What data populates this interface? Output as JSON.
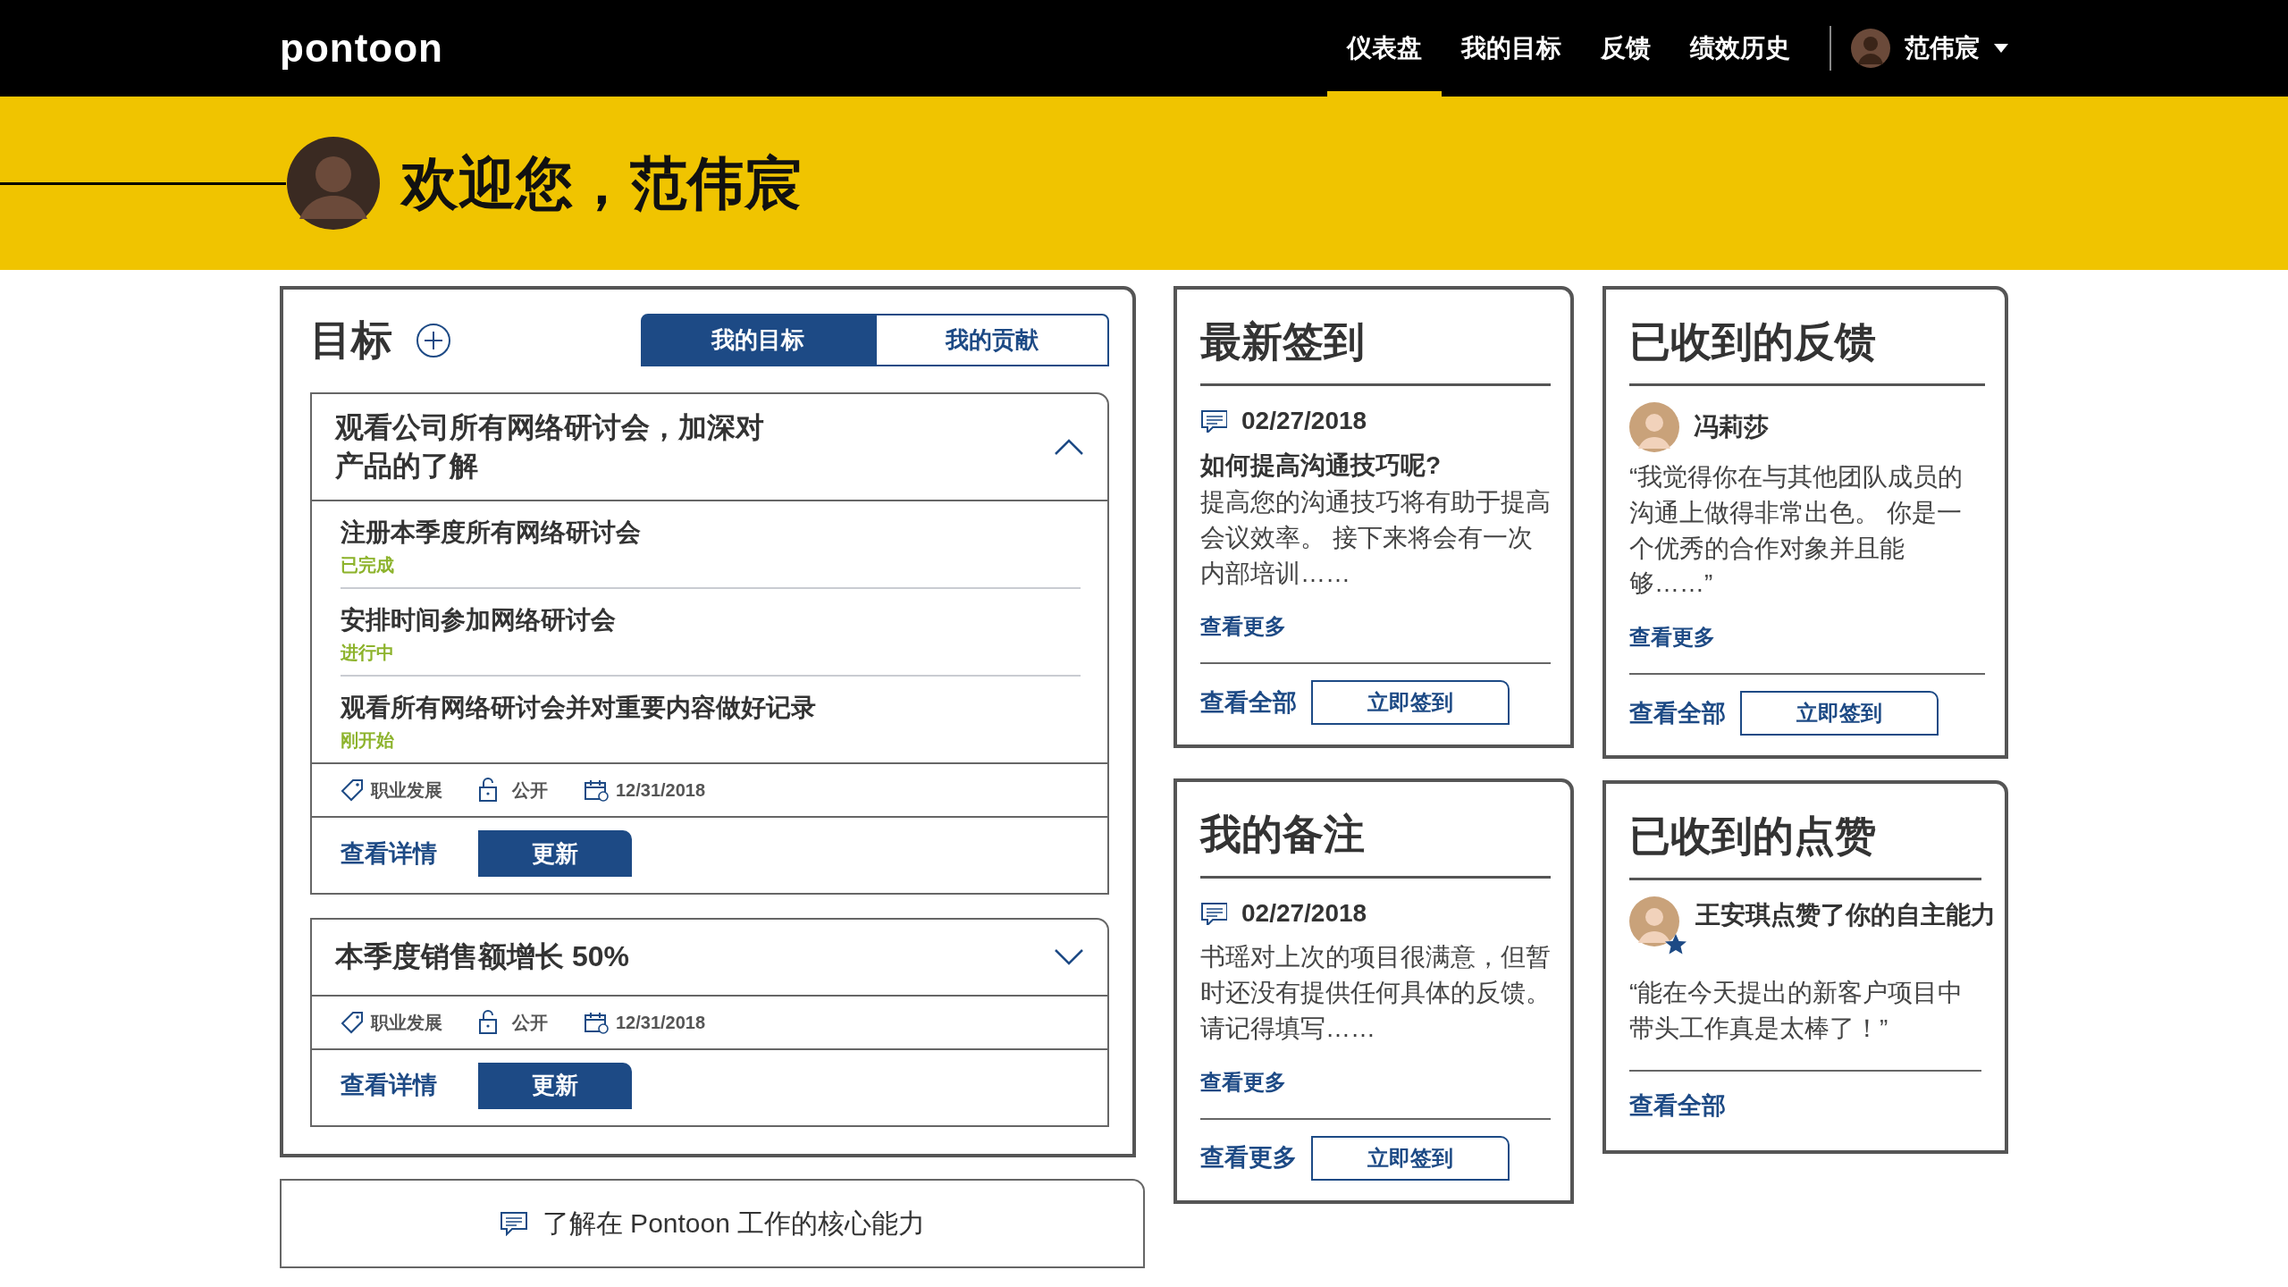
{
  "navbar": {
    "logo": "pontoon",
    "links": [
      {
        "label": "仪表盘",
        "selected": true
      },
      {
        "label": "我的目标",
        "selected": false
      },
      {
        "label": "反馈",
        "selected": false
      },
      {
        "label": "绩效历史",
        "selected": false
      }
    ],
    "user": {
      "name": "范伟宸"
    }
  },
  "banner": {
    "greeting": "欢迎您，范伟宸"
  },
  "goals": {
    "title": "目标",
    "tabs": [
      {
        "label": "我的目标",
        "selected": true
      },
      {
        "label": "我的贡献",
        "selected": false
      }
    ],
    "items": [
      {
        "title": "观看公司所有网络研讨会，加深对产品的了解",
        "expanded": true,
        "subtasks": [
          {
            "title": "注册本季度所有网络研讨会",
            "status": "已完成"
          },
          {
            "title": "安排时间参加网络研讨会",
            "status": "进行中"
          },
          {
            "title": "观看所有网络研讨会并对重要内容做好记录",
            "status": "刚开始"
          }
        ],
        "category": "职业发展",
        "visibility": "公开",
        "due": "12/31/2018",
        "details_link": "查看详情",
        "update_button": "更新"
      },
      {
        "title": "本季度销售额增长 50%",
        "expanded": false,
        "category": "职业发展",
        "visibility": "公开",
        "due": "12/31/2018",
        "details_link": "查看详情",
        "update_button": "更新"
      }
    ]
  },
  "competency_link": "了解在 Pontoon 工作的核心能力",
  "checkins": {
    "title": "最新签到",
    "date": "02/27/2018",
    "heading": "如何提高沟通技巧呢?",
    "text": "提高您的沟通技巧将有助于提高会议效率。 接下来将会有一次内部培训……",
    "more_link": "查看更多",
    "footer_link": "查看全部",
    "button": "立即签到"
  },
  "notes": {
    "title": "我的备注",
    "date": "02/27/2018",
    "paragraphs": [
      "书瑶对上次的项目很满意，但暂时还没有提供任何具体的反馈。",
      "请记得填写……"
    ],
    "more_link": "查看更多",
    "footer_link": "查看更多",
    "button": "立即签到"
  },
  "feedback": {
    "title": "已收到的反馈",
    "author": "冯莉莎",
    "quote": "“我觉得你在与其他团队成员的沟通上做得非常出色。 你是一个优秀的合作对象并且能够……”",
    "more_link": "查看更多",
    "footer_link": "查看全部",
    "button": "立即签到"
  },
  "kudos": {
    "title": "已收到的点赞",
    "message": "王安琪点赞了你的自主能力",
    "quote": "“能在今天提出的新客户项目中带头工作真是太棒了！”",
    "footer_link": "查看全部"
  }
}
